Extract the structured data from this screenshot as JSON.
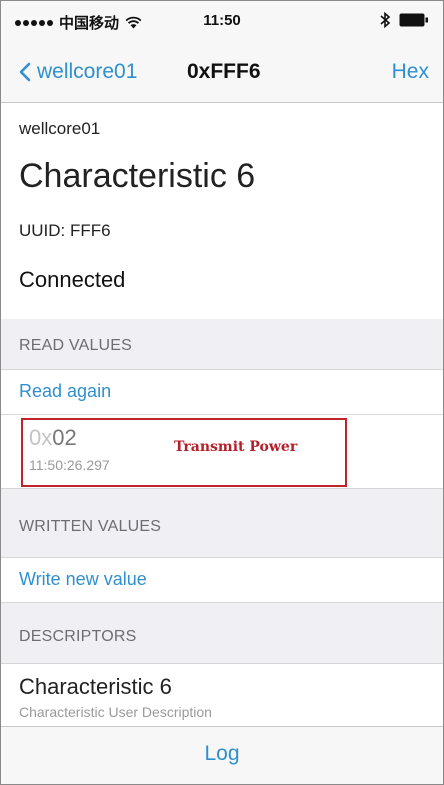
{
  "status_bar": {
    "carrier": "中国移动",
    "time": "11:50",
    "icons": [
      "signal-dots-icon",
      "wifi-icon",
      "bluetooth-icon",
      "battery-icon"
    ]
  },
  "nav": {
    "back_label": "wellcore01",
    "title": "0xFFF6",
    "right_label": "Hex"
  },
  "header": {
    "device_name": "wellcore01",
    "characteristic_title": "Characteristic 6",
    "uuid": "UUID: FFF6",
    "status": "Connected"
  },
  "read_values": {
    "section_title": "READ VALUES",
    "action_label": "Read again",
    "value_prefix": "0x",
    "value": "02",
    "timestamp": "11:50:26.297",
    "annotation": "Transmit Power"
  },
  "written_values": {
    "section_title": "WRITTEN VALUES",
    "action_label": "Write new value"
  },
  "descriptors": {
    "section_title": "DESCRIPTORS",
    "items": [
      {
        "title": "Characteristic 6",
        "subtitle": "Characteristic User Description"
      }
    ]
  },
  "toolbar": {
    "log_label": "Log"
  },
  "colors": {
    "accent": "#2f8fcf",
    "annotation_red": "#c0232b",
    "section_bg": "#efeff4"
  }
}
